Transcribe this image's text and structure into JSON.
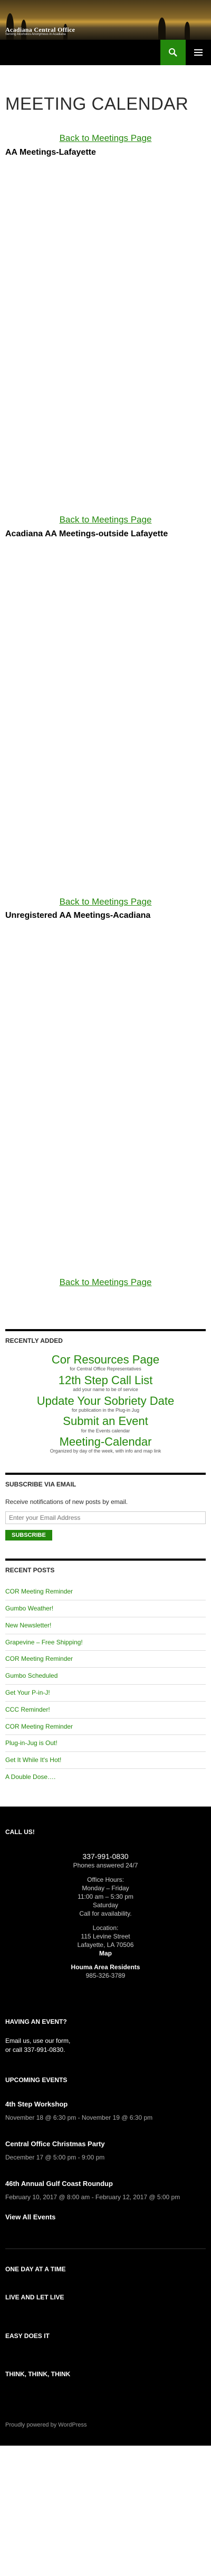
{
  "site": {
    "title": "Acadiana Central Office",
    "description": "Serving Alcoholics Anonymous in Acadiana",
    "accent": "#24890d"
  },
  "header": {
    "search_icon": "search-icon",
    "menu_icon": "hamburger-menu-icon"
  },
  "page": {
    "title": "MEETING CALENDAR",
    "back_link": "Back to Meetings Page",
    "sections": [
      "AA Meetings-Lafayette",
      "Acadiana AA Meetings-outside Lafayette",
      "Unregistered AA Meetings-Acadiana"
    ]
  },
  "recently_added": {
    "heading": "RECENTLY ADDED",
    "items": [
      {
        "title": "Cor Resources Page",
        "sub": "for Central Office Representatives"
      },
      {
        "title": "12th Step Call List",
        "sub": "add your name to be of service"
      },
      {
        "title": "Update Your Sobriety Date",
        "sub": "for publication in the Plug-in Jug"
      },
      {
        "title": "Submit an Event",
        "sub": "for the Events calendar"
      },
      {
        "title": "Meeting-Calendar",
        "sub": "Organized by day of the week, with info and map link"
      }
    ]
  },
  "subscribe": {
    "heading": "SUBSCRIBE VIA EMAIL",
    "text": "Receive notifications of new posts by email.",
    "placeholder": "Enter your Email Address",
    "button": "SUBSCRIBE"
  },
  "recent_posts": {
    "heading": "RECENT POSTS",
    "items": [
      "COR Meeting Reminder",
      "Gumbo Weather!",
      "New Newsletter!",
      "Grapevine – Free Shipping!",
      "COR Meeting Reminder",
      "Gumbo Scheduled",
      "Get Your P-in-J!",
      "CCC Reminder!",
      "COR Meeting Reminder",
      "Plug-in-Jug is Out!",
      "Get It While It's Hot!",
      "A Double Dose…."
    ]
  },
  "footer": {
    "call_us": {
      "heading": "CALL US!",
      "phone": "337-991-0830",
      "phone_note": "Phones answered 24/7",
      "hours_label": "Office Hours:",
      "hours_days": "Monday – Friday",
      "hours_time": "11:00 am – 5:30 pm",
      "saturday": "Saturday",
      "saturday_note": "Call for availability.",
      "location_label": "Location:",
      "address_1": "115 Levine Street",
      "address_2": "Lafayette, LA 70506",
      "map": "Map",
      "houma_label": "Houma Area Residents",
      "houma_phone": "985-326-3789"
    },
    "having_event": {
      "heading": "HAVING AN EVENT?",
      "line1": "Email us, use our form,",
      "line2": "or call 337-991-0830."
    },
    "upcoming": {
      "heading": "UPCOMING EVENTS",
      "events": [
        {
          "name": "4th Step Workshop",
          "date": "November 18 @ 6:30 pm - November 19 @ 6:30 pm"
        },
        {
          "name": "Central Office Christmas Party",
          "date": "December 17 @ 5:00 pm - 9:00 pm"
        },
        {
          "name": "46th Annual Gulf Coast Roundup",
          "date": "February 10, 2017 @ 8:00 am - February 12, 2017 @ 5:00 pm"
        }
      ],
      "view_all": "View All Events"
    },
    "links": [
      "ONE DAY AT A TIME",
      "LIVE AND LET LIVE",
      "EASY DOES IT",
      "THINK, THINK, THINK"
    ],
    "powered": "Proudly powered by WordPress"
  }
}
